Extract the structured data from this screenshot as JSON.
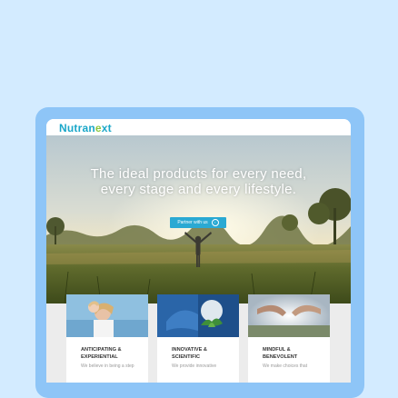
{
  "brand": {
    "logo_main": "Nutran",
    "logo_accent": "e",
    "logo_tail": "xt"
  },
  "hero": {
    "headline_line1": "The ideal products for every need,",
    "headline_line2": "every stage and every lifestyle.",
    "cta_label": "Partner with us",
    "cta_icon": "arrow-right-circle-icon"
  },
  "cards": [
    {
      "title_line1": "ANTICIPATING &",
      "title_line2": "EXPERIENTIAL",
      "text": "We believe in being a step"
    },
    {
      "title_line1": "INNOVATIVE &",
      "title_line2": "SCIENTIFIC",
      "text": "We provide innovative"
    },
    {
      "title_line1": "MINDFUL &",
      "title_line2": "BENEVOLENT",
      "text": "We make choices that"
    }
  ],
  "colors": {
    "page_bg": "#d3ebff",
    "device_frame": "#8ec5f7",
    "brand_teal": "#1aa7c9",
    "brand_green": "#8cc63f",
    "cta": "#2aa9d3"
  }
}
